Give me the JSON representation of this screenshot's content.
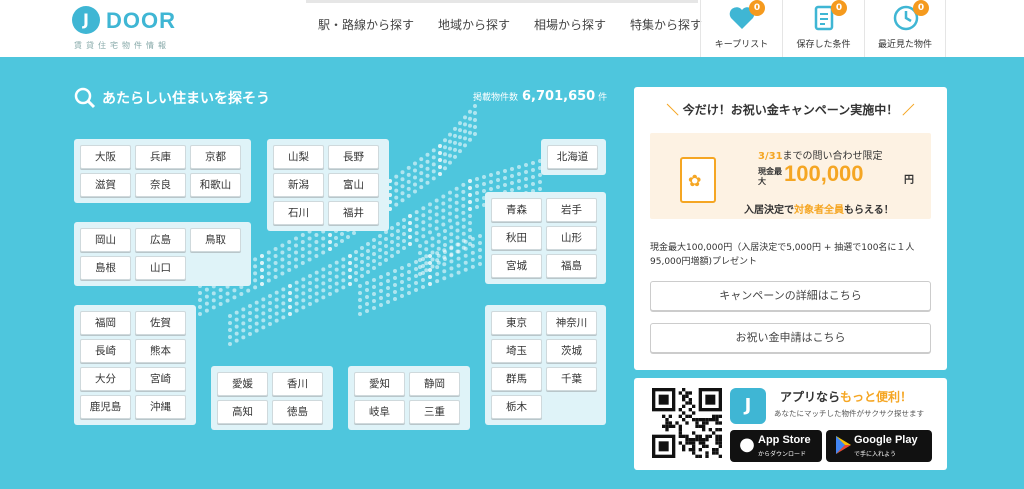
{
  "header": {
    "logo_mark": "J",
    "logo_text": "DOOR",
    "logo_sub": "賃貸住宅物件情報",
    "nav": [
      "駅・路線から探す",
      "地域から探す",
      "相場から探す",
      "特集から探す"
    ],
    "icons": [
      {
        "icon": "heart-icon",
        "label": "キープリスト",
        "badge": "0"
      },
      {
        "icon": "document-icon",
        "label": "保存した条件",
        "badge": "0"
      },
      {
        "icon": "clock-icon",
        "label": "最近見た物件",
        "badge": "0"
      }
    ]
  },
  "search": {
    "title": "あたらしい住まいを探そう",
    "count_label": "掲載物件数",
    "count_value": "6,701,650",
    "count_unit": "件"
  },
  "regions": {
    "kinki": [
      "大阪",
      "兵庫",
      "京都",
      "滋賀",
      "奈良",
      "和歌山"
    ],
    "chugoku": [
      "岡山",
      "広島",
      "鳥取",
      "島根",
      "山口"
    ],
    "kyushu": [
      "福岡",
      "佐賀",
      "長崎",
      "熊本",
      "大分",
      "宮崎",
      "鹿児島",
      "沖縄"
    ],
    "shikoku": [
      "愛媛",
      "香川",
      "高知",
      "徳島"
    ],
    "koshinetsu": [
      "山梨",
      "長野",
      "新潟",
      "富山",
      "石川",
      "福井"
    ],
    "tokai": [
      "愛知",
      "静岡",
      "岐阜",
      "三重"
    ],
    "hokkaido": [
      "北海道"
    ],
    "tohoku": [
      "青森",
      "岩手",
      "秋田",
      "山形",
      "宮城",
      "福島"
    ],
    "kanto": [
      "東京",
      "神奈川",
      "埼玉",
      "茨城",
      "群馬",
      "千葉",
      "栃木"
    ]
  },
  "campaign": {
    "title": "今だけ！お祝い金キャンペーン実施中！",
    "deadline": "3/31",
    "line1_rest": "までの問い合わせ限定",
    "amount_prefix": "現金最大",
    "amount": "100,000",
    "amount_unit": "円",
    "line3_a": "入居決定で",
    "line3_hl": "対象者全員",
    "line3_b": "もらえる！",
    "description": "現金最大100,000円（入居決定で5,000円 + 抽選で100名に１人95,000円増額)プレゼント",
    "btn_details": "キャンペーンの詳細はこちら",
    "btn_apply": "お祝い金申請はこちら"
  },
  "app": {
    "logo_mark": "J",
    "title_a": "アプリなら",
    "title_hl": "もっと便利",
    "title_b": "！",
    "subtitle": "あなたにマッチした物件がサクサク探せます",
    "apple_name": "App Store",
    "apple_sub": "からダウンロード",
    "google_name": "Google Play",
    "google_sub": "で手に入れよう"
  },
  "colors": {
    "background": "#4ec6dd",
    "accent": "#f5a623",
    "brand": "#3fb6d4"
  }
}
